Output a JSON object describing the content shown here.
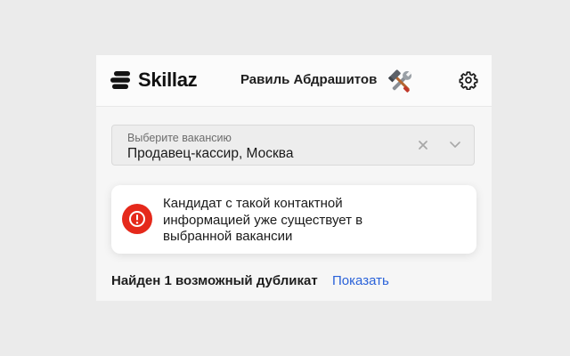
{
  "header": {
    "logo_text": "Skillaz",
    "user_name": "Равиль Абдрашитов",
    "avatar_icon": "hammer-wrench-icon",
    "settings_icon": "gear-icon"
  },
  "vacancy_select": {
    "label": "Выберите вакансию",
    "value": "Продавец-кассир, Москва",
    "clear_icon": "close-icon",
    "dropdown_icon": "chevron-down-icon"
  },
  "alert": {
    "icon": "error-icon",
    "message": "Кандидат с такой контактной информацией уже существует в выбранной вакансии",
    "color": "#e5291b"
  },
  "duplicates": {
    "text": "Найден 1 возможный дубликат",
    "link": "Показать",
    "link_color": "#2a62d9"
  }
}
